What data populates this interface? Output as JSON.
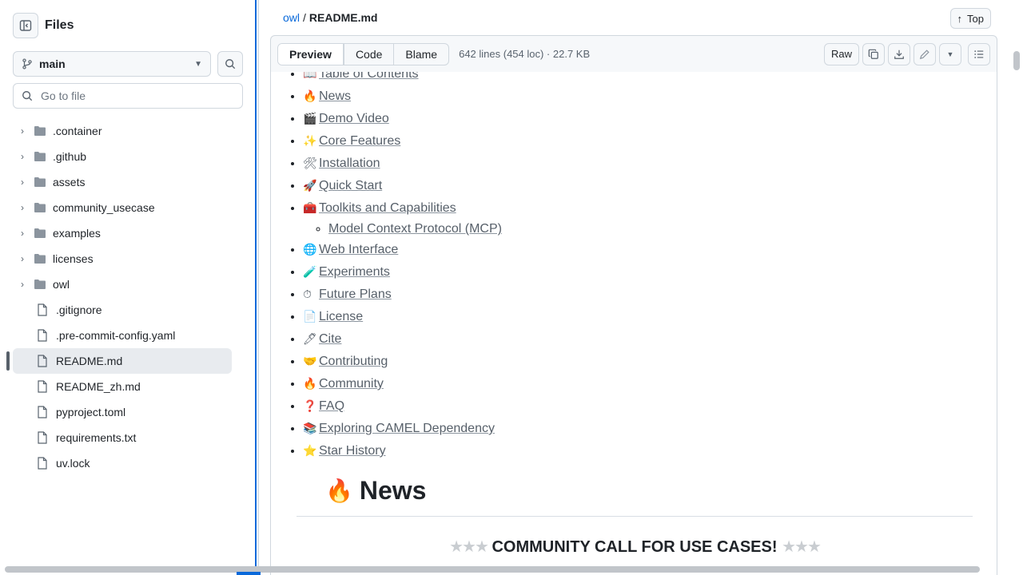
{
  "sidebar": {
    "title": "Files",
    "branch": "main",
    "goto_placeholder": "Go to file",
    "items": [
      {
        "label": ".container",
        "type": "folder"
      },
      {
        "label": ".github",
        "type": "folder"
      },
      {
        "label": "assets",
        "type": "folder"
      },
      {
        "label": "community_usecase",
        "type": "folder"
      },
      {
        "label": "examples",
        "type": "folder"
      },
      {
        "label": "licenses",
        "type": "folder"
      },
      {
        "label": "owl",
        "type": "folder"
      },
      {
        "label": ".gitignore",
        "type": "file"
      },
      {
        "label": ".pre-commit-config.yaml",
        "type": "file"
      },
      {
        "label": "README.md",
        "type": "file",
        "selected": true
      },
      {
        "label": "README_zh.md",
        "type": "file"
      },
      {
        "label": "pyproject.toml",
        "type": "file"
      },
      {
        "label": "requirements.txt",
        "type": "file"
      },
      {
        "label": "uv.lock",
        "type": "file"
      }
    ]
  },
  "header": {
    "repo": "owl",
    "separator": "/",
    "file": "README.md",
    "top_label": "Top"
  },
  "toolbar": {
    "tabs": [
      "Preview",
      "Code",
      "Blame"
    ],
    "meta": "642 lines (454 loc) · 22.7 KB",
    "raw_label": "Raw"
  },
  "toc": {
    "partial_top": "Table of Contents",
    "items": [
      {
        "emoji": "🔥",
        "label": "News"
      },
      {
        "emoji": "🎬",
        "label": "Demo Video"
      },
      {
        "emoji": "✨",
        "label": "Core Features"
      },
      {
        "emoji": "🛠",
        "label": "Installation"
      },
      {
        "emoji": "🚀",
        "label": "Quick Start"
      },
      {
        "emoji": "🧰",
        "label": "Toolkits and Capabilities"
      },
      {
        "emoji": "",
        "label": "Model Context Protocol (MCP)",
        "sub": true
      },
      {
        "emoji": "🌐",
        "label": "Web Interface"
      },
      {
        "emoji": "🧪",
        "label": "Experiments"
      },
      {
        "emoji": "⏱",
        "label": "Future Plans"
      },
      {
        "emoji": "📄",
        "label": "License"
      },
      {
        "emoji": "🖊",
        "label": "Cite"
      },
      {
        "emoji": "🤝",
        "label": "Contributing"
      },
      {
        "emoji": "🔥",
        "label": "Community"
      },
      {
        "emoji": "❓",
        "label": "FAQ"
      },
      {
        "emoji": "📚",
        "label": "Exploring CAMEL Dependency"
      },
      {
        "emoji": "⭐",
        "label": "Star History"
      }
    ]
  },
  "news": {
    "emoji": "🔥",
    "heading": "News",
    "callout_stars": "★★★",
    "callout": "COMMUNITY CALL FOR USE CASES!"
  },
  "colors": {
    "accent": "#0969da",
    "folder": "#8b949e",
    "text": "#1f2328"
  }
}
